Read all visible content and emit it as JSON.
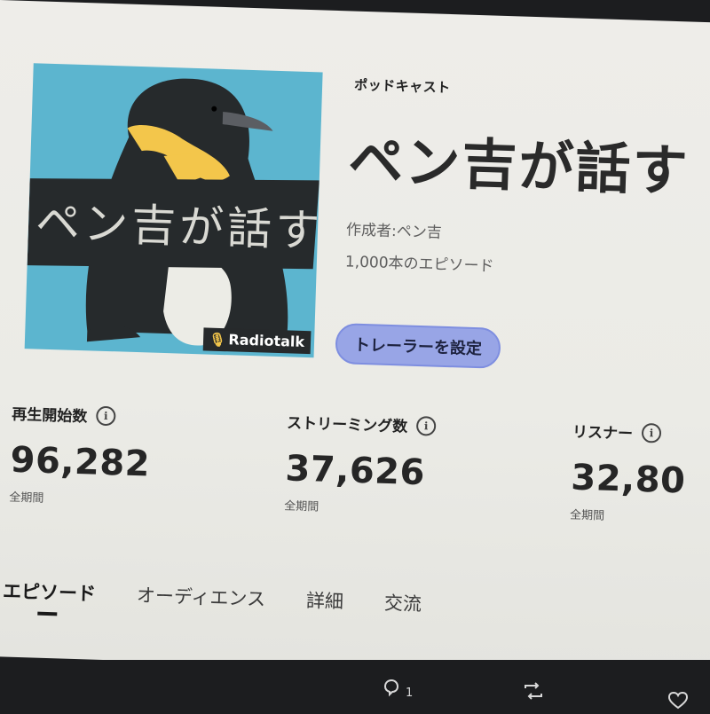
{
  "podcast": {
    "kind": "ポッドキャスト",
    "title": "ペン吉が話す",
    "author": "作成者:ペン吉",
    "episodes": "1,000本のエピソード",
    "trailer_button": "トレーラーを設定",
    "artwork": {
      "handwritten_text": "ペン吉が話す",
      "badge": "Radiotalk",
      "colors": {
        "background": "#5cb5cf",
        "penguin": "#262a2c",
        "scarf": "#f3c64b"
      }
    }
  },
  "stats": [
    {
      "label": "再生開始数",
      "value": "96,282",
      "period": "全期間",
      "icon": "info-icon"
    },
    {
      "label": "ストリーミング数",
      "value": "37,626",
      "period": "全期間",
      "icon": "info-icon"
    },
    {
      "label": "リスナー",
      "value": "32,80",
      "period": "全期間",
      "icon": "info-icon"
    }
  ],
  "tabs": [
    {
      "label": "エピソード",
      "active": true
    },
    {
      "label": "オーディエンス",
      "active": false
    },
    {
      "label": "詳細",
      "active": false
    },
    {
      "label": "交流",
      "active": false
    }
  ],
  "footer": {
    "reply_count": "1",
    "icons": [
      "reply-icon",
      "retweet-icon",
      "like-icon"
    ]
  },
  "colors": {
    "accent": "#98a5e6",
    "text": "#262626"
  }
}
